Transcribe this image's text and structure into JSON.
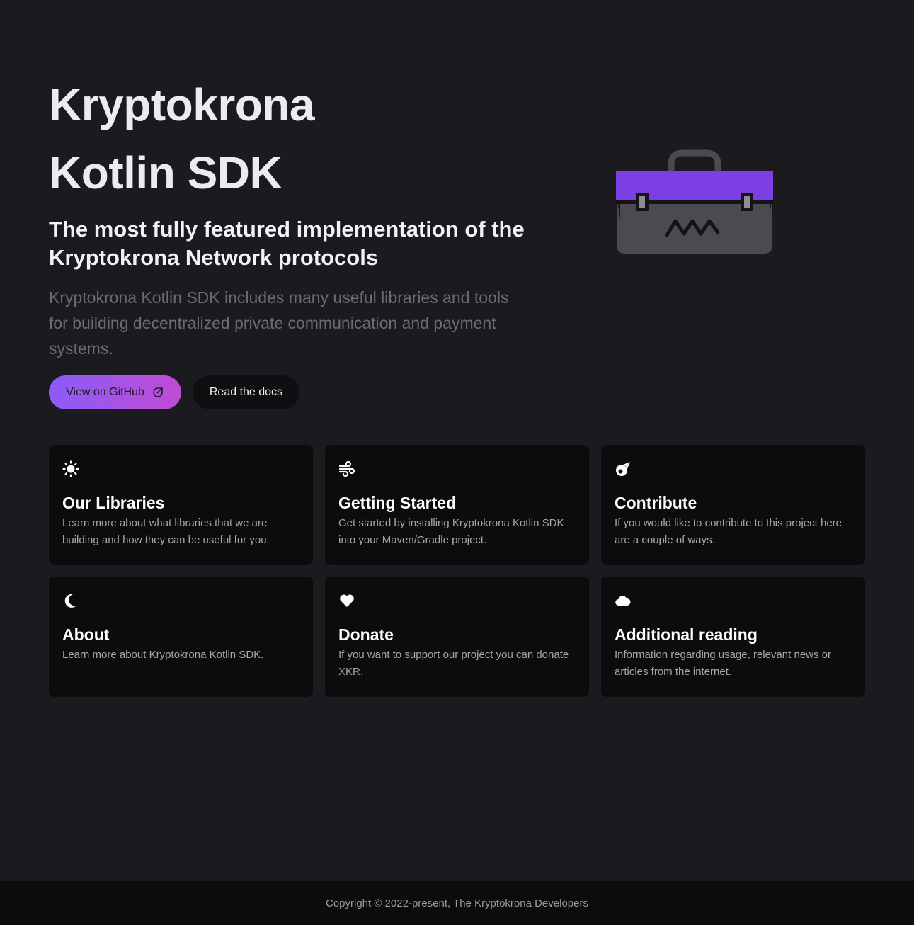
{
  "hero": {
    "name_line1": "Kryptokrona",
    "name_line2": "Kotlin SDK",
    "tagline": "The most fully featured implementation of the Kryptokrona Network protocols",
    "description": "Kryptokrona Kotlin SDK includes many useful libraries and tools for building decentralized private communication and payment systems.",
    "actions": {
      "github_label": "View on GitHub",
      "docs_label": "Read the docs"
    },
    "colors": {
      "bag_lid": "#7b3fe4",
      "bag_body": "#4a4a4f",
      "accent_gradient_start": "#8b5cf6",
      "accent_gradient_end": "#c04bd6"
    }
  },
  "features": [
    {
      "icon": "sun-icon",
      "title": "Our Libraries",
      "details": "Learn more about what libraries that we are building and how they can be useful for you."
    },
    {
      "icon": "wind-icon",
      "title": "Getting Started",
      "details": "Get started by installing Kryptokrona Kotlin SDK into your Maven/Gradle project."
    },
    {
      "icon": "meteor-icon",
      "title": "Contribute",
      "details": "If you would like to contribute to this project here are a couple of ways."
    },
    {
      "icon": "moon-icon",
      "title": "About",
      "details": "Learn more about Kryptokrona Kotlin SDK."
    },
    {
      "icon": "heart-icon",
      "title": "Donate",
      "details": "If you want to support our project you can donate XKR."
    },
    {
      "icon": "cloud-icon",
      "title": "Additional reading",
      "details": "Information regarding usage, relevant news or articles from the internet."
    }
  ],
  "footer": {
    "copyright": "Copyright © 2022-present, The Kryptokrona Developers"
  }
}
